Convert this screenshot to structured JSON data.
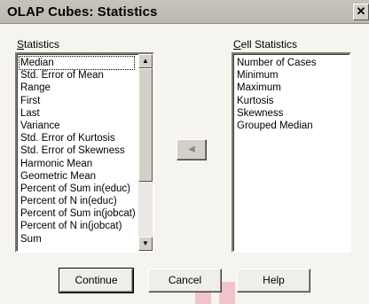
{
  "window": {
    "title": "OLAP Cubes: Statistics",
    "close_glyph": "✕"
  },
  "statistics": {
    "label_mnemonic": "S",
    "label_rest": "tatistics",
    "items": [
      "Median",
      "Std. Error of Mean",
      "Range",
      "First",
      "Last",
      "Variance",
      "Std. Error of Kurtosis",
      "Std. Error of Skewness",
      "Harmonic Mean",
      "Geometric Mean",
      "Percent of Sum in(educ)",
      "Percent of N in(educ)",
      "Percent of Sum in(jobcat)",
      "Percent of N in(jobcat)",
      "Sum"
    ],
    "selected_item": "Median"
  },
  "cell_statistics": {
    "label_mnemonic": "C",
    "label_rest": "ell Statistics",
    "items": [
      "Number of Cases",
      "Minimum",
      "Maximum",
      "Kurtosis",
      "Skewness",
      "Grouped Median"
    ]
  },
  "move_button": {
    "icon": "left-arrow-icon",
    "glyph": "◀"
  },
  "buttons": {
    "continue": "Continue",
    "cancel": "Cancel",
    "help": "Help"
  }
}
